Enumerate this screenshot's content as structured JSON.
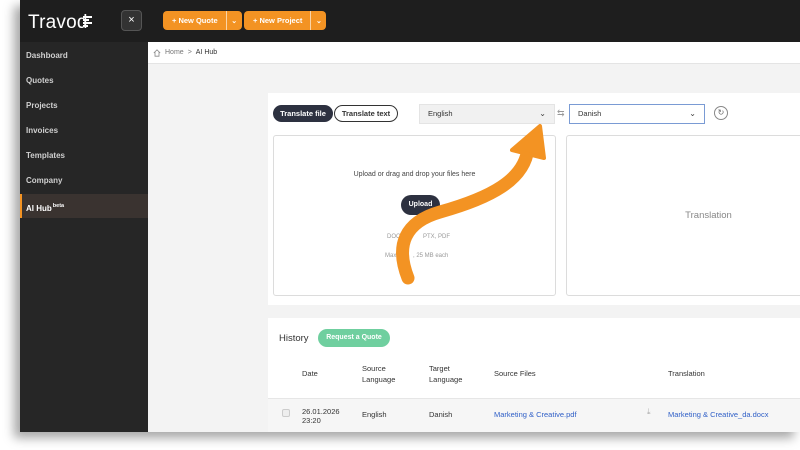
{
  "app": {
    "logo_text": "Travod",
    "close_label": "×",
    "new_quote": "+ New Quote",
    "new_project": "+ New Project",
    "caret": "⌄"
  },
  "sidebar": {
    "items": [
      {
        "label": "Dashboard"
      },
      {
        "label": "Quotes"
      },
      {
        "label": "Projects"
      },
      {
        "label": "Invoices"
      },
      {
        "label": "Templates"
      },
      {
        "label": "Company"
      },
      {
        "label": "AI Hub",
        "badge": "beta",
        "active": true
      }
    ]
  },
  "breadcrumb": {
    "home": "Home",
    "separator": ">",
    "current": "AI Hub"
  },
  "translate": {
    "tab_file": "Translate file",
    "tab_text": "Translate text",
    "source_lang": "English",
    "target_lang": "Danish",
    "dropzone_title": "Upload or drag and drop your files here",
    "upload_button": "Upload",
    "formats_visible": "DOCX, X",
    "formats_tail": "PTX, PDF",
    "limit_visible": "Max 10",
    "limit_tail": ", 25 MB each",
    "output_placeholder": "Translation"
  },
  "history": {
    "title": "History",
    "request_quote": "Request a Quote",
    "columns": [
      "Date",
      "Source\nLanguage",
      "Target\nLanguage",
      "Source Files",
      "Translation"
    ],
    "rows": [
      {
        "date": "26.01.2026",
        "time": "23:20",
        "source_language": "English",
        "target_language": "Danish",
        "source_file": "Marketing & Creative.pdf",
        "translation_file": "Marketing & Creative_da.docx"
      }
    ]
  },
  "colors": {
    "accent_orange": "#f39323",
    "dark_navy": "#2d3140",
    "green": "#6fcf9f",
    "link_blue": "#2f5fc7"
  }
}
